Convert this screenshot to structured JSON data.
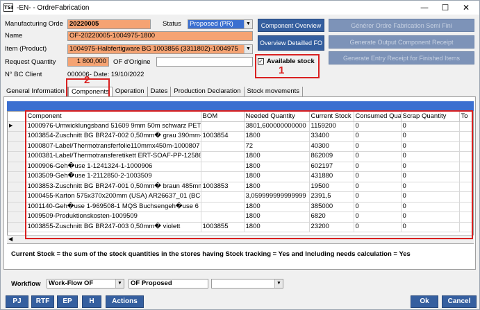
{
  "window": {
    "title": "-EN- - OrdreFabrication",
    "app_icon": "TSI"
  },
  "header": {
    "mo_label": "Manufacturing Orde",
    "mo_value": "20220005",
    "status_label": "Status",
    "status_value": "Proposed (PR)",
    "name_label": "Name",
    "name_value": "OF-20220005-1004975-1800",
    "item_label": "Item (Product)",
    "item_value": "1004975-Halbfertigware BG 1003856 (3311802)-1004975",
    "qty_label": "Request Quantity",
    "qty_value": "1 800,000",
    "origin_label": "OF d'Origine",
    "origin_value": "",
    "bc_label": "N° BC Client",
    "bc_value": "000006- Date: 19/10/2022",
    "available_stock_label": "Available stock",
    "available_stock_checked": true
  },
  "buttons": {
    "component_overview": "Component Overview",
    "overview_detailled": "Overview Detailled FO",
    "generer_semi": "Générer Ordre Fabrication Semi Fini",
    "generate_output": "Generate Output Component Receipt",
    "generate_entry": "Generate Entry Receipt for Finished Items"
  },
  "annotations": {
    "one": "1",
    "two": "2"
  },
  "tabs": [
    {
      "label": "General Information"
    },
    {
      "label": "Components"
    },
    {
      "label": "Operation"
    },
    {
      "label": "Dates"
    },
    {
      "label": "Production Declaration"
    },
    {
      "label": "Stock movements"
    }
  ],
  "grid": {
    "columns": [
      "Component",
      "BOM",
      "Needed Quantity",
      "Current Stock",
      "Consumed Qua",
      "Scrap Quantity",
      "To"
    ],
    "rows": [
      [
        "1000976-Umwicklungsband 51609 9mm 50m schwarz PET-",
        "",
        "3801,600000000000",
        "1159200",
        "0",
        "0"
      ],
      [
        "1003854-Zuschnitt BG BR247-002 0,50mm� grau 390mm-",
        "1003854",
        "1800",
        "33400",
        "0",
        "0"
      ],
      [
        "1000807-Label/Thermotransferfolie110mmx450m-1000807",
        "",
        "72",
        "40300",
        "0",
        "0"
      ],
      [
        "1000381-Label/Thermotransferetikett ERT-SOAF-PP-12586",
        "",
        "1800",
        "862009",
        "0",
        "0"
      ],
      [
        "1000906-Geh�use 1-1241324-1-1000906",
        "",
        "1800",
        "602197",
        "0",
        "0"
      ],
      [
        "1003509-Geh�use 1-2112850-2-1003509",
        "",
        "1800",
        "431880",
        "0",
        "0"
      ],
      [
        "1003853-Zuschnitt BG BR247-001 0,50mm� braun 485mm",
        "1003853",
        "1800",
        "19500",
        "0",
        "0"
      ],
      [
        "1000455-Karton 575x370x200mm (USA) AR26637_01 (BC-",
        "",
        "3,059999999999999",
        "2391,5",
        "0",
        "0"
      ],
      [
        "1001140-Geh�use 1-969508-1 MQS Buchsengeh�use 6",
        "",
        "1800",
        "385000",
        "0",
        "0"
      ],
      [
        "1009509-Produktionskosten-1009509",
        "",
        "1800",
        "6820",
        "0",
        "0"
      ],
      [
        "1003855-Zuschnitt BG BR247-003 0,50mm� violett",
        "1003855",
        "1800",
        "23200",
        "0",
        "0"
      ]
    ]
  },
  "note": "Current Stock = the sum of the stock quantities in the stores having Stock tracking = Yes and Including needs calculation = Yes",
  "footer": {
    "workflow_label": "Workflow",
    "workflow_value": "Work-Flow OF",
    "workflow_state": "OF Proposed",
    "workflow_extra": "",
    "pj": "PJ",
    "rtf": "RTF",
    "ep": "EP",
    "h": "H",
    "actions": "Actions",
    "ok": "Ok",
    "cancel": "Cancel"
  },
  "colors": {
    "accent": "#355f9f",
    "highlight": "#f5a373",
    "annotation": "#d92020"
  }
}
